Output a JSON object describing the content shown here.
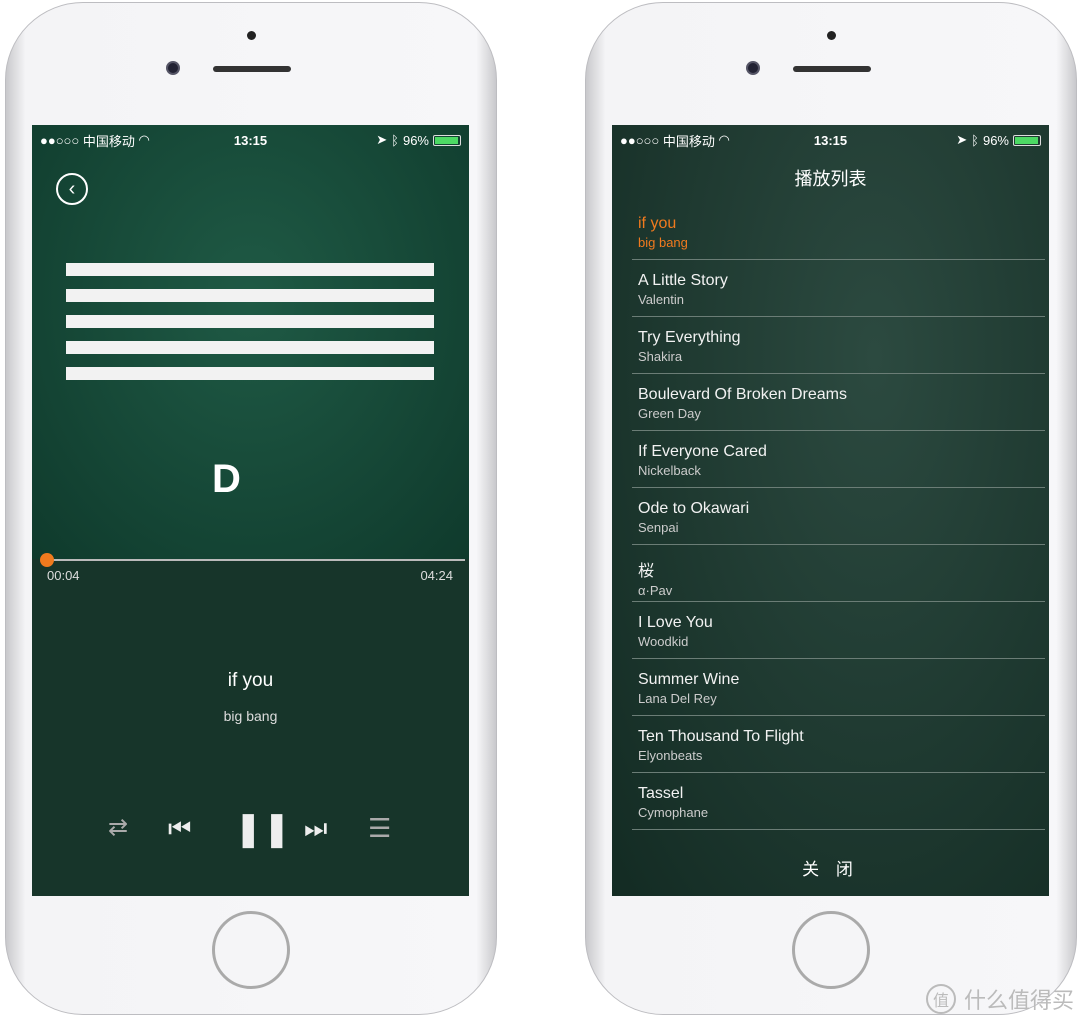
{
  "status": {
    "signal": "●●○○○",
    "carrier": "中国移动",
    "time": "13:15",
    "battery": "96%",
    "battery_level": 0.96
  },
  "player": {
    "back_icon": "chevron-left-icon",
    "elapsed": "00:04",
    "duration": "04:24",
    "progress": 0.015,
    "title": "if you",
    "artist": "big bang",
    "album_logo": "D",
    "accent": "#f07a1e"
  },
  "controls": {
    "repeat": "⇄",
    "prev": "⏮",
    "pause": "❚❚",
    "next": "⏭",
    "playlist": "☰"
  },
  "playlist": {
    "title": "播放列表",
    "close": "关 闭",
    "items": [
      {
        "name": "if you",
        "artist": "big bang",
        "active": true
      },
      {
        "name": "A Little Story",
        "artist": "Valentin"
      },
      {
        "name": "Try Everything",
        "artist": "Shakira"
      },
      {
        "name": "Boulevard Of Broken Dreams",
        "artist": "Green Day"
      },
      {
        "name": "If Everyone Cared",
        "artist": "Nickelback"
      },
      {
        "name": "Ode to Okawari",
        "artist": "Senpai"
      },
      {
        "name": "桜",
        "artist": "α·Pav"
      },
      {
        "name": "I Love You",
        "artist": "Woodkid"
      },
      {
        "name": "Summer Wine",
        "artist": "Lana Del Rey"
      },
      {
        "name": "Ten Thousand To Flight",
        "artist": "Elyonbeats"
      },
      {
        "name": "Tassel",
        "artist": "Cymophane"
      }
    ]
  },
  "watermark": {
    "badge": "值",
    "text": "什么值得买"
  }
}
